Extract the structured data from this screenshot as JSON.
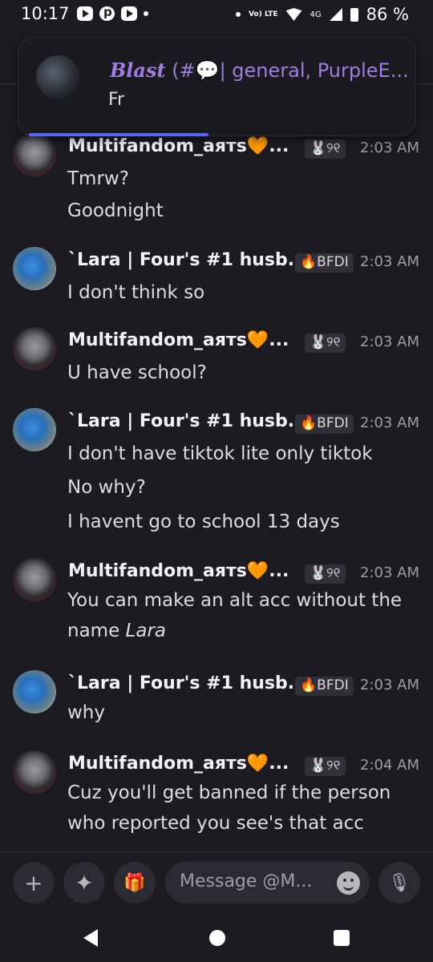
{
  "status_bar": {
    "time": "10:17",
    "network_label": "Vo) LTE",
    "network_type": "4G",
    "battery": "86 %"
  },
  "notification": {
    "sender": "Blast",
    "channel_prefix": " (#",
    "channel_emoji": "💬",
    "channel": "| general, PurpleE...",
    "body": "Fr"
  },
  "messages": [
    {
      "username": "Multifandom_аятs",
      "tag": "🐰୨୧",
      "time": "2:03 AM",
      "avatar": "multifandom-avatar",
      "lines": [
        "Tmrw?",
        "Goodnight"
      ]
    },
    {
      "username": "`Lara | Four's #1 husb...",
      "tag": "🔥BFDI",
      "time": "2:03 AM",
      "avatar": "lara-avatar",
      "lines": [
        "I don't think so"
      ]
    },
    {
      "username": "Multifandom_аятs",
      "tag": "🐰୨୧",
      "time": "2:03 AM",
      "avatar": "multifandom-avatar",
      "lines": [
        "U have school?"
      ]
    },
    {
      "username": "`Lara | Four's #1 husb...",
      "tag": "🔥BFDI",
      "time": "2:03 AM",
      "avatar": "lara-avatar",
      "lines": [
        "I don't have tiktok lite only tiktok",
        "No why?",
        "I havent go to school 13 days"
      ]
    },
    {
      "username": "Multifandom_аятs",
      "tag": "🐰୨୧",
      "time": "2:03 AM",
      "avatar": "multifandom-avatar",
      "lines": [
        "You can make an alt acc without the",
        "name "
      ],
      "italic_tail": "Lara"
    },
    {
      "username": "`Lara | Four's #1 husb...",
      "tag": "🔥BFDI",
      "time": "2:03 AM",
      "avatar": "lara-avatar",
      "lines": [
        "why"
      ]
    },
    {
      "username": "Multifandom_аятs",
      "tag": "🐰୨୧",
      "time": "2:04 AM",
      "avatar": "multifandom-avatar",
      "lines": [
        "Cuz you'll get banned if the person",
        "who reported you see's that acc"
      ]
    }
  ],
  "composer": {
    "placeholder": "Message @M...",
    "add_glyph": "+",
    "apps_glyph": "✦",
    "gift_glyph": "🎁",
    "mic_glyph": "🎙"
  },
  "colors": {
    "background": "#1b1b21",
    "accent": "#5865f2",
    "channel_purple": "#a27ce0"
  }
}
